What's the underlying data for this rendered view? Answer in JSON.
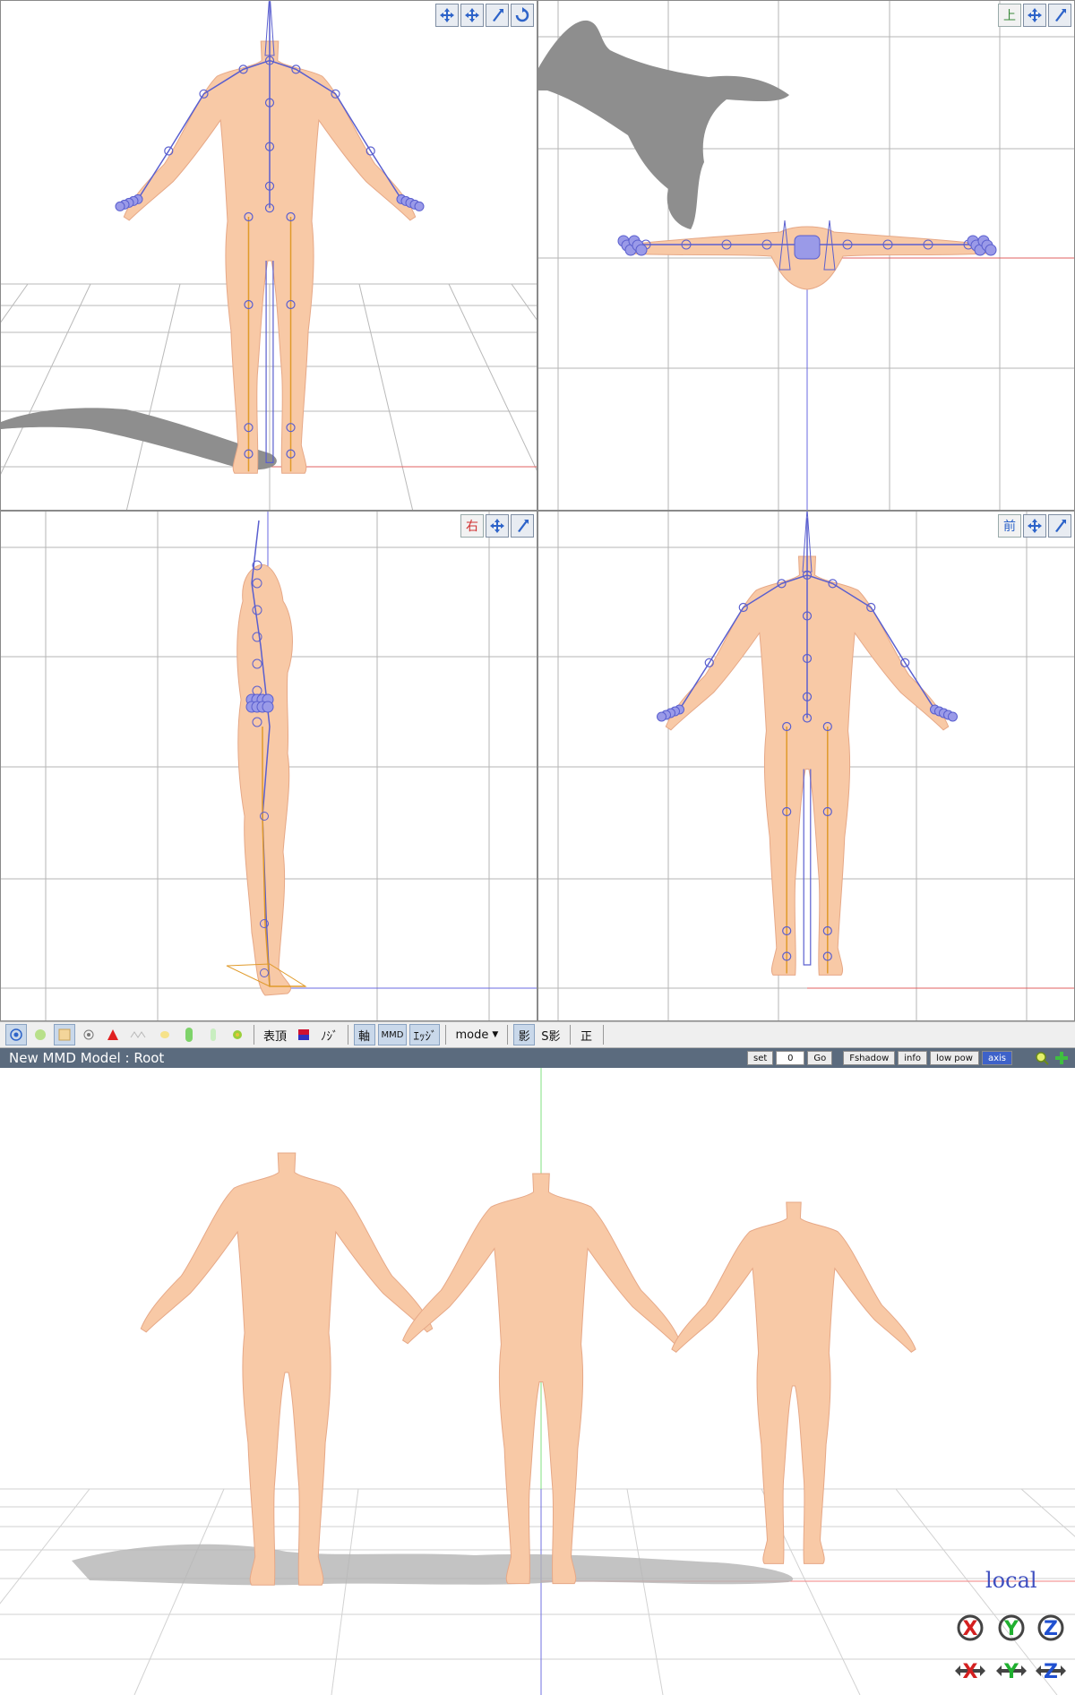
{
  "viewports": {
    "perspective": {
      "tools": [
        "move-view-icon",
        "pan-view-icon",
        "zoom-view-icon",
        "rotate-view-icon"
      ]
    },
    "top": {
      "label": "上",
      "tools": [
        "move-view-icon",
        "zoom-view-icon"
      ]
    },
    "right": {
      "label": "右",
      "tools": [
        "move-view-icon",
        "zoom-view-icon"
      ]
    },
    "front": {
      "label": "前",
      "tools": [
        "move-view-icon",
        "zoom-view-icon"
      ]
    }
  },
  "toolbar": {
    "labels": {
      "hyouchou": "表頂",
      "ji": "ﾉｼﾞ",
      "jiku": "軸",
      "mmd": "MMD",
      "edge": "ｴｯｼﾞ",
      "mode": "mode",
      "kage": "影",
      "skage": "S影",
      "sei": "正"
    },
    "colors": {
      "accent": "#c9d8ea",
      "bone": "#5a5fcf",
      "ik": "#e09a2a"
    }
  },
  "status": {
    "title": "New MMD Model : Root",
    "set_label": "set",
    "frame_value": "0",
    "go_label": "Go",
    "fshadow_label": "Fshadow",
    "info_label": "info",
    "lowpow_label": "low pow",
    "axis_label": "axis"
  },
  "render": {
    "local_label": "local",
    "axis_buttons": [
      "X",
      "Y",
      "Z"
    ]
  },
  "colors": {
    "skin": "#f8c9a6",
    "skin_stroke": "#e6a887",
    "shadow": "#8c8c8c",
    "grid": "#b0b0b0",
    "status_bg": "#5b6b7e"
  }
}
